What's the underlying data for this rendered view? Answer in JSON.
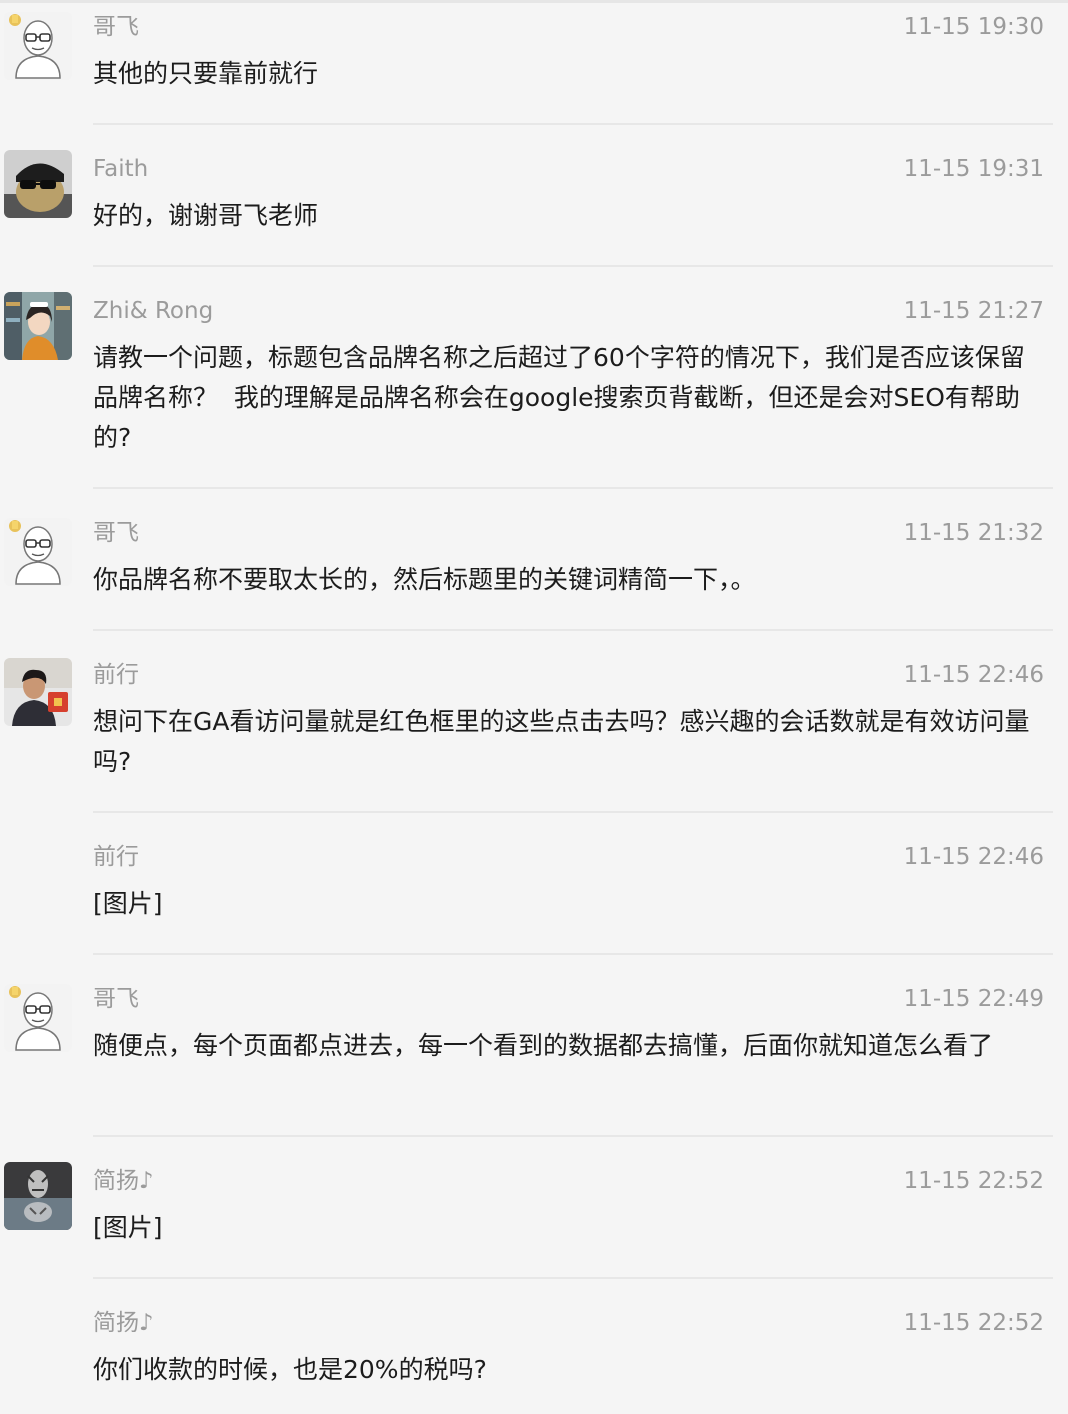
{
  "messages": [
    {
      "sender": "哥飞",
      "time": "11-15 19:30",
      "text": "其他的只要靠前就行",
      "avatar": "gefei-avatar"
    },
    {
      "sender": "Faith",
      "time": "11-15 19:31",
      "text": "好的，谢谢哥飞老师",
      "avatar": "faith-avatar"
    },
    {
      "sender": "Zhi& Rong",
      "time": "11-15 21:27",
      "text": "请教一个问题，标题包含品牌名称之后超过了60个字符的情况下，我们是否应该保留品牌名称？  我的理解是品牌名称会在google搜索页背截断，但还是会对SEO有帮助的?",
      "avatar": "zhirong-avatar"
    },
    {
      "sender": "哥飞",
      "time": "11-15 21:32",
      "text": "你品牌名称不要取太长的，然后标题里的关键词精简一下，。",
      "avatar": "gefei-avatar"
    },
    {
      "sender": "前行",
      "time": "11-15 22:46",
      "text": "想问下在GA看访问量就是红色框里的这些点击去吗？感兴趣的会话数就是有效访问量吗?",
      "avatar": "qianxing-avatar"
    },
    {
      "sender": "前行",
      "time": "11-15 22:46",
      "text": "[图片]",
      "avatar": ""
    },
    {
      "sender": "哥飞",
      "time": "11-15 22:49",
      "text": "随便点，每个页面都点进去，每一个看到的数据都去搞懂，后面你就知道怎么看了",
      "avatar": "gefei-avatar"
    },
    {
      "sender": "简扬♪",
      "time": "11-15 22:52",
      "text": "[图片]",
      "avatar": "jianyang-avatar"
    },
    {
      "sender": "简扬♪",
      "time": "11-15 22:52",
      "text": "你们收款的时候，也是20%的税吗?",
      "avatar": ""
    }
  ]
}
